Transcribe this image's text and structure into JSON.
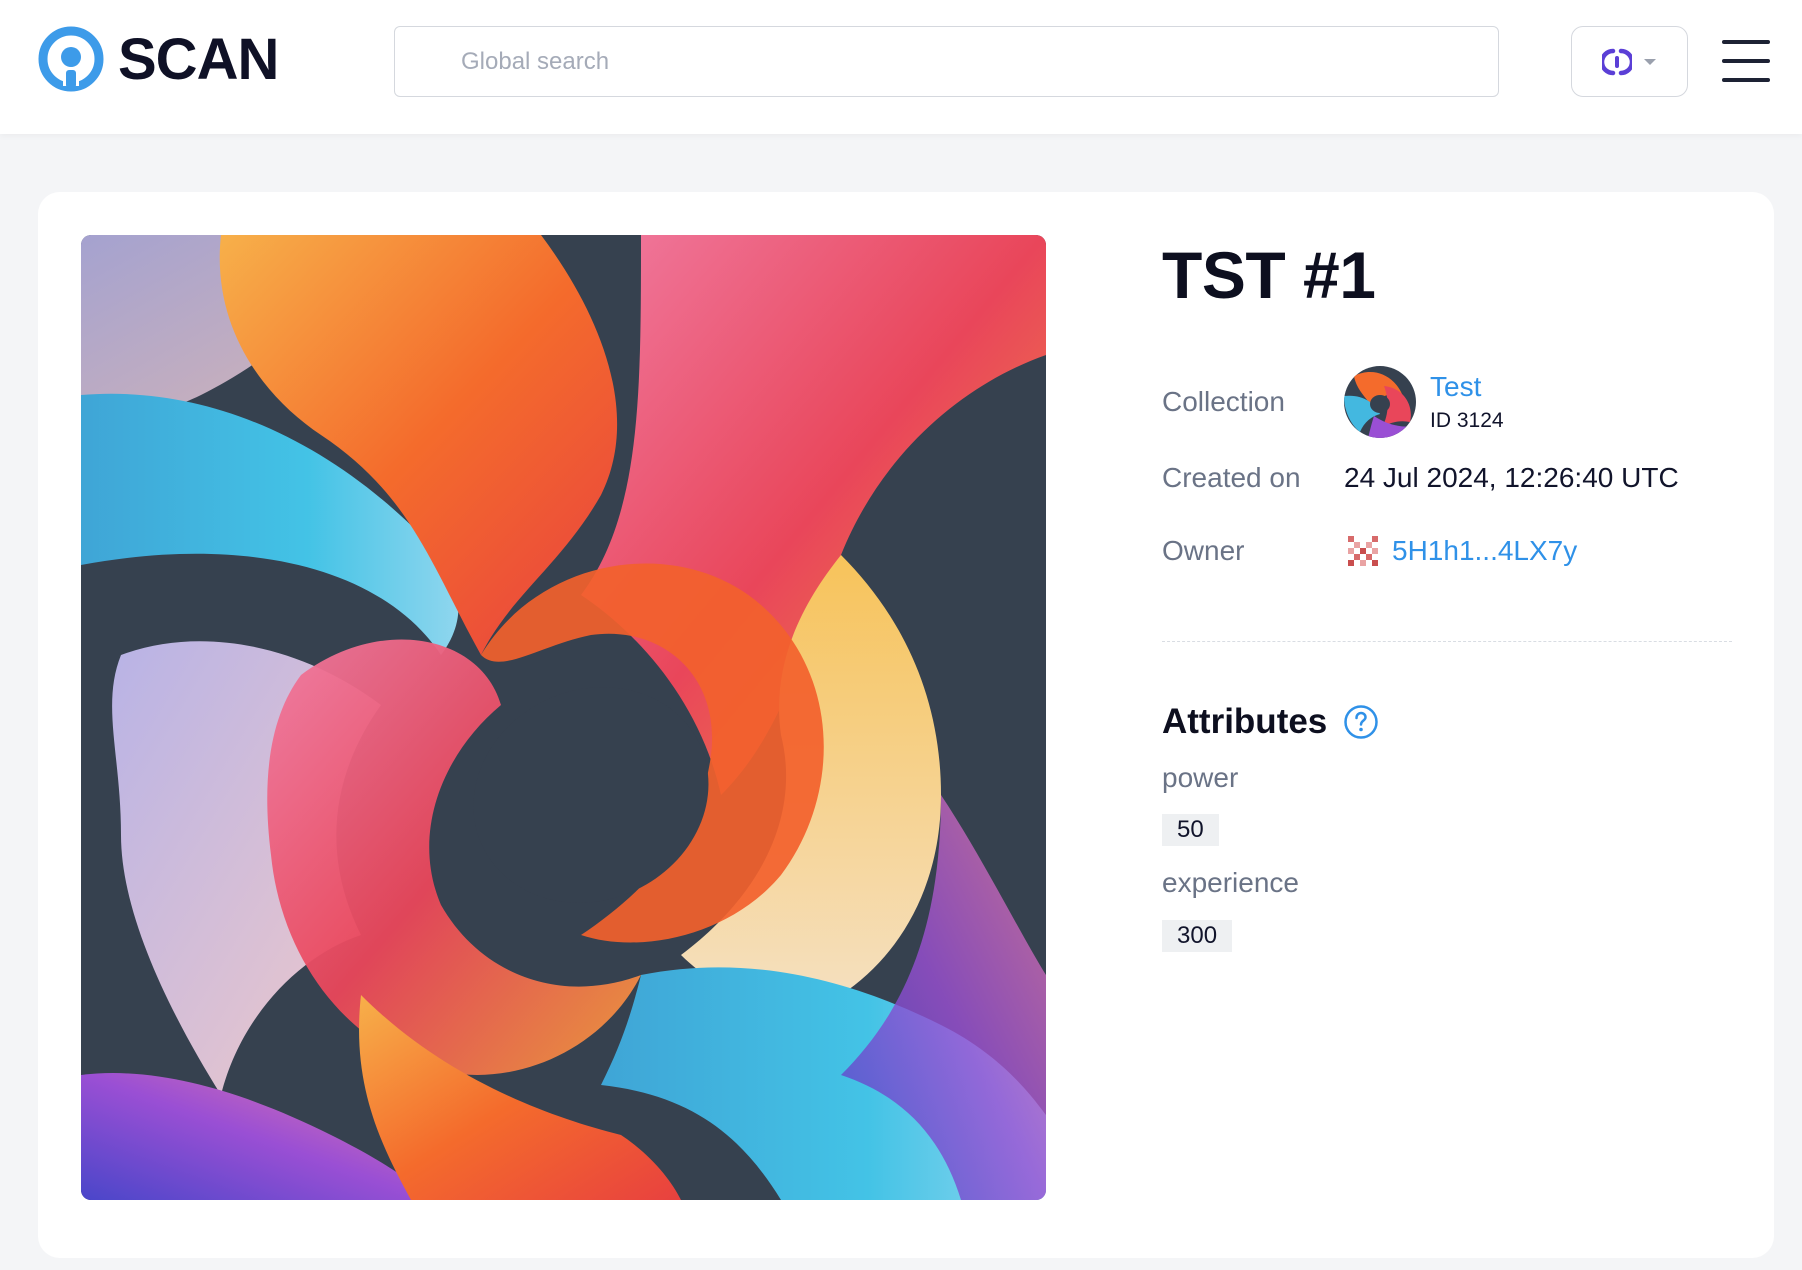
{
  "header": {
    "logo_text": "SCAN",
    "search_placeholder": "Global search",
    "network_icon": "network-selector-icon",
    "menu_icon": "hamburger-menu-icon"
  },
  "token": {
    "title": "TST #1",
    "collection": {
      "label": "Collection",
      "name": "Test",
      "id_text": "ID 3124"
    },
    "created": {
      "label": "Created on",
      "value": "24 Jul 2024, 12:26:40 UTC"
    },
    "owner": {
      "label": "Owner",
      "address": "5H1h1...4LX7y"
    },
    "attributes": {
      "title": "Attributes",
      "items": [
        {
          "name": "power",
          "value": "50"
        },
        {
          "name": "experience",
          "value": "300"
        }
      ]
    }
  },
  "colors": {
    "link": "#2f91e8",
    "logo_accent": "#3d9be9",
    "network_accent": "#5b3fd6",
    "artwork_bg": "#36414f"
  }
}
